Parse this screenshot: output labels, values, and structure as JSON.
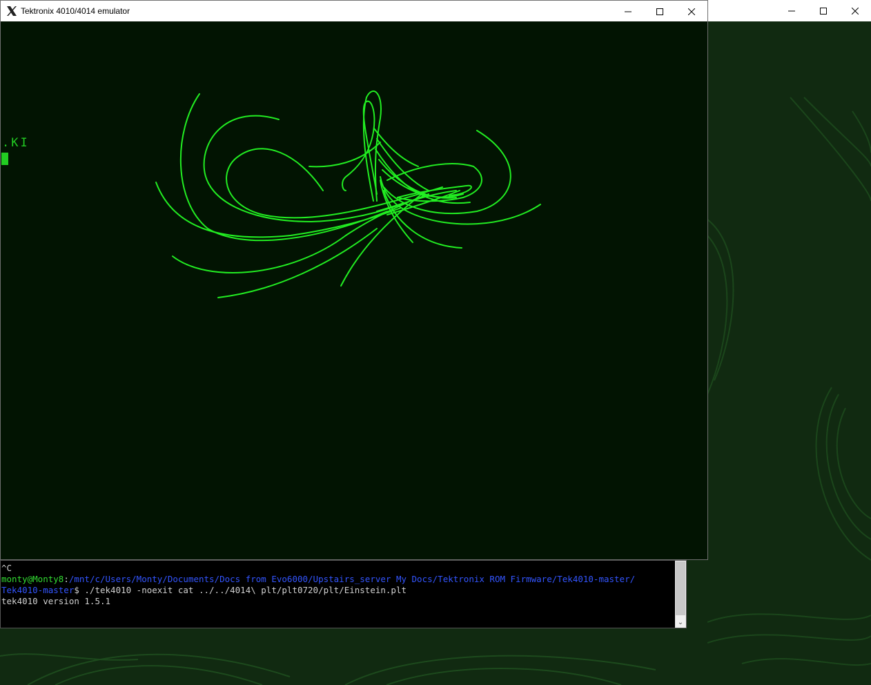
{
  "tek_window": {
    "title": "Tektronix 4010/4014 emulator",
    "icon": "x-logo-icon",
    "screen_text": ".KI",
    "controls": [
      "minimize",
      "maximize",
      "close"
    ]
  },
  "background_window": {
    "controls": [
      "minimize",
      "maximize",
      "close"
    ]
  },
  "terminal": {
    "line1": "^C",
    "prompt_user": "monty@Monty8",
    "prompt_colon": ":",
    "prompt_path_1": "/mnt/c/Users/Monty/Documents/Docs from Evo6000/Upstairs_server My Docs/Tektronix ROM Firmware/Tek4010-master/",
    "prompt_path_2": "Tek4010-master",
    "command": "$ ./tek4010 -noexit cat ../../4014\\ plt/plt0720/plt/Einstein.plt",
    "output": "tek4010 version 1.5.1"
  },
  "colors": {
    "plot_green": "#22ee22",
    "terminal_green": "#33dd33",
    "terminal_blue": "#3355ff"
  }
}
